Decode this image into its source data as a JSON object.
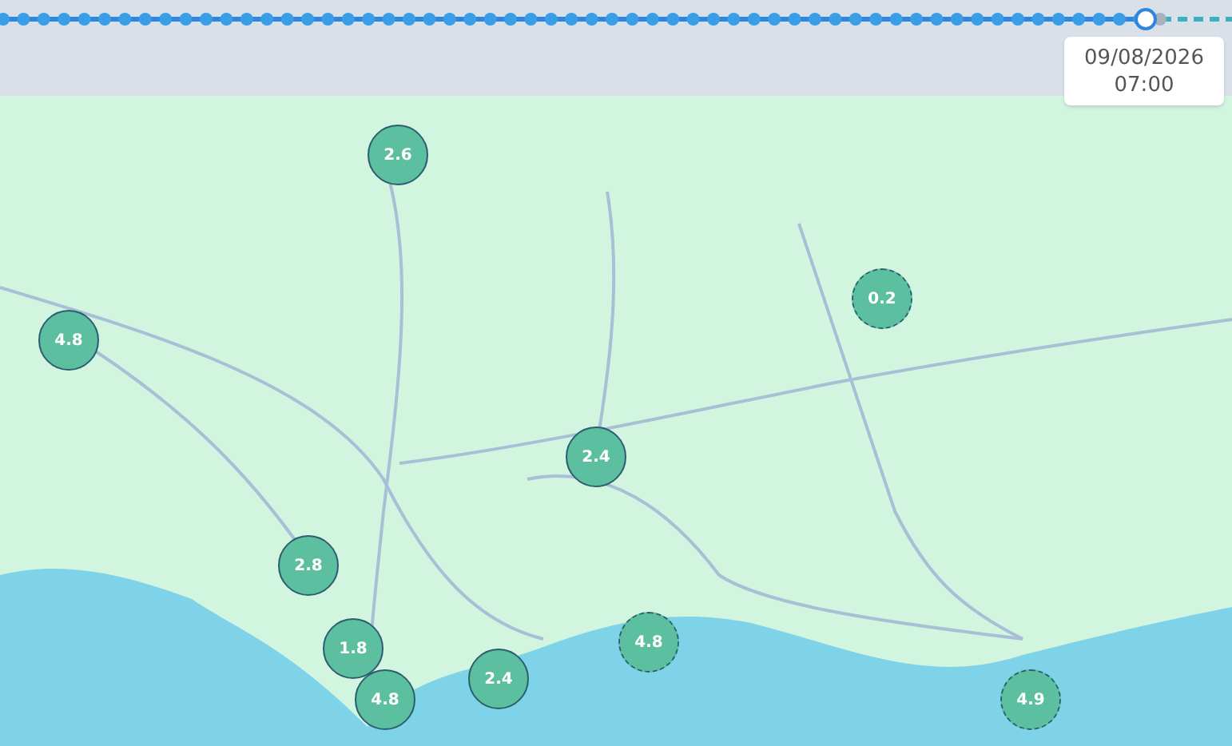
{
  "timeline": {
    "level": 0.93,
    "date": "09/08/2026",
    "time": "07:00"
  },
  "markers": [
    {
      "value": "2.6",
      "kind": "solid"
    },
    {
      "value": "4.8",
      "kind": "solid"
    },
    {
      "value": "0.2",
      "kind": "dashed"
    },
    {
      "value": "2.4",
      "kind": "solid"
    },
    {
      "value": "2.8",
      "kind": "solid"
    },
    {
      "value": "1.8",
      "kind": "solid"
    },
    {
      "value": "4.8",
      "kind": "solid"
    },
    {
      "value": "2.4",
      "kind": "solid"
    },
    {
      "value": "4.8",
      "kind": "dashed"
    },
    {
      "value": "4.9",
      "kind": "dashed"
    }
  ]
}
